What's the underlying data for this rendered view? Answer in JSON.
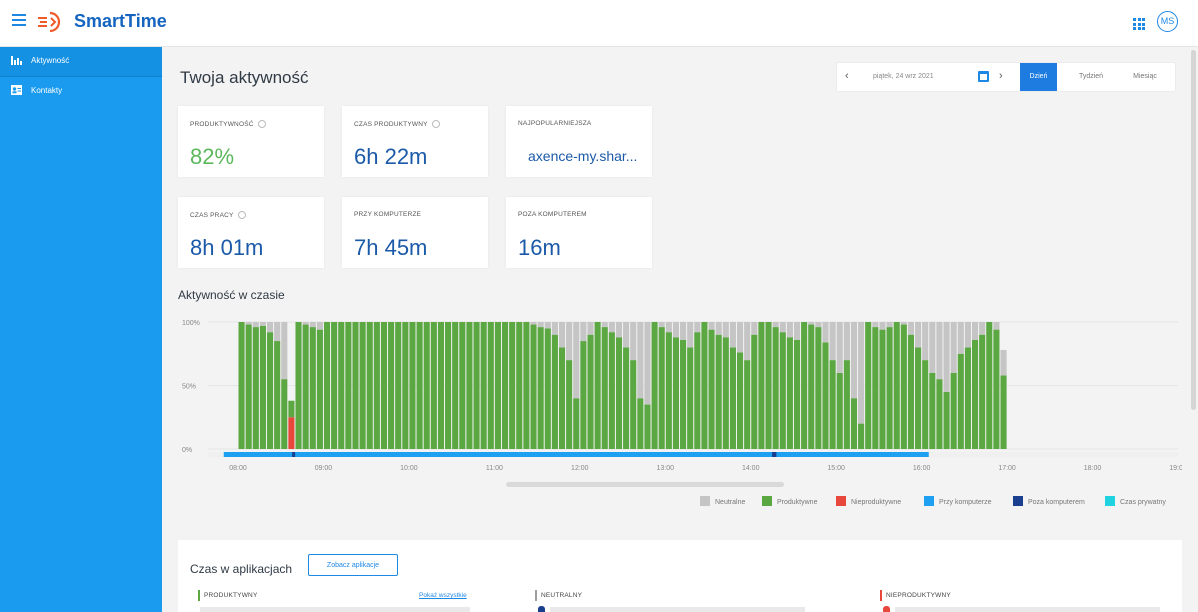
{
  "app": {
    "brand": "SmartTime",
    "user_initials": "MS"
  },
  "sidebar": {
    "items": [
      {
        "label": "Aktywność",
        "icon": "bar-chart-icon",
        "active": true
      },
      {
        "label": "Kontakty",
        "icon": "contact-card-icon",
        "active": false
      }
    ]
  },
  "page": {
    "title": "Twoja aktywność"
  },
  "date_nav": {
    "date": "piątek, 24 wrz 2021",
    "tabs": [
      {
        "label": "Dzień",
        "active": true
      },
      {
        "label": "Tydzień",
        "active": false
      },
      {
        "label": "Miesiąc",
        "active": false
      }
    ]
  },
  "stats": {
    "productivity": {
      "label": "PRODUKTYWNOŚĆ",
      "value": "82%"
    },
    "productive_time": {
      "label": "CZAS PRODUKTYWNY",
      "value": "6h 22m"
    },
    "most_popular": {
      "label": "NAJPOPULARNIEJSZA",
      "value": "axence-my.shar..."
    },
    "work_time": {
      "label": "CZAS PRACY",
      "value": "8h 01m"
    },
    "at_computer": {
      "label": "PRZY KOMPUTERZE",
      "value": "7h 45m"
    },
    "away": {
      "label": "POZA KOMPUTEREM",
      "value": "16m"
    }
  },
  "activity_section": {
    "title": "Aktywność w czasie"
  },
  "chart_data": {
    "type": "bar",
    "stacked": true,
    "y_ticks": [
      "100%",
      "50%",
      "0%"
    ],
    "ylim": [
      0,
      100
    ],
    "x_ticks": [
      "08:00",
      "09:00",
      "10:00",
      "11:00",
      "12:00",
      "13:00",
      "14:00",
      "15:00",
      "16:00",
      "17:00",
      "18:00",
      "19:00"
    ],
    "grid": true,
    "legend_position": "bottom-right",
    "bucket_minutes": 5,
    "start_time": "07:50",
    "productive": [
      0,
      0,
      100,
      98,
      96,
      97,
      92,
      85,
      55,
      13,
      100,
      98,
      96,
      94,
      100,
      100,
      100,
      100,
      100,
      100,
      100,
      100,
      100,
      100,
      100,
      100,
      100,
      100,
      100,
      100,
      100,
      100,
      100,
      100,
      100,
      100,
      100,
      100,
      100,
      100,
      100,
      100,
      100,
      98,
      96,
      95,
      90,
      80,
      70,
      40,
      85,
      90,
      100,
      96,
      92,
      88,
      80,
      70,
      40,
      35,
      100,
      96,
      92,
      88,
      86,
      80,
      92,
      100,
      94,
      90,
      88,
      80,
      76,
      70,
      90,
      100,
      100,
      96,
      92,
      88,
      86,
      100,
      98,
      96,
      84,
      70,
      60,
      70,
      40,
      20,
      100,
      96,
      94,
      96,
      100,
      98,
      90,
      80,
      70,
      60,
      55,
      45,
      60,
      75,
      80,
      86,
      90,
      100,
      94,
      58
    ],
    "unproductive": [
      0,
      0,
      0,
      0,
      0,
      0,
      0,
      0,
      0,
      25,
      0,
      0,
      0,
      0,
      0,
      0,
      0,
      0,
      0,
      0,
      0,
      0,
      0,
      0,
      0,
      0,
      0,
      0,
      0,
      0,
      0,
      0,
      0,
      0,
      0,
      0,
      0,
      0,
      0,
      0,
      0,
      0,
      0,
      0,
      0,
      0,
      0,
      0,
      0,
      0,
      0,
      0,
      0,
      0,
      0,
      0,
      0,
      0,
      0,
      0,
      0,
      0,
      0,
      0,
      0,
      0,
      0,
      0,
      0,
      0,
      0,
      0,
      0,
      0,
      0,
      0,
      0,
      0,
      0,
      0,
      0,
      0,
      0,
      0,
      0,
      0,
      0,
      0,
      0,
      0,
      0,
      0,
      0,
      0,
      0,
      0,
      0,
      0,
      0,
      0,
      0,
      0,
      0,
      0,
      0,
      0,
      0,
      0,
      0,
      0
    ],
    "neutral": [
      0,
      0,
      0,
      2,
      4,
      3,
      8,
      15,
      45,
      0,
      0,
      2,
      4,
      6,
      0,
      0,
      0,
      0,
      0,
      0,
      0,
      0,
      0,
      0,
      0,
      0,
      0,
      0,
      0,
      0,
      0,
      0,
      0,
      0,
      0,
      0,
      0,
      0,
      0,
      0,
      0,
      0,
      0,
      2,
      4,
      5,
      10,
      20,
      30,
      60,
      15,
      10,
      0,
      4,
      8,
      12,
      20,
      30,
      60,
      65,
      0,
      4,
      8,
      12,
      14,
      20,
      8,
      0,
      6,
      10,
      12,
      20,
      24,
      30,
      10,
      0,
      0,
      4,
      8,
      12,
      14,
      0,
      2,
      4,
      16,
      30,
      40,
      30,
      60,
      80,
      0,
      4,
      6,
      4,
      0,
      2,
      10,
      20,
      30,
      40,
      45,
      55,
      40,
      25,
      20,
      14,
      10,
      0,
      6,
      20
    ],
    "timeline": {
      "at_computer": [
        [
          "07:50",
          "16:05"
        ]
      ],
      "away": [
        [
          "08:38",
          "08:40"
        ],
        [
          "14:15",
          "14:18"
        ]
      ]
    },
    "series_colors": {
      "neutral": "#c5c5c5",
      "productive": "#5ba843",
      "unproductive": "#e8473c",
      "at_computer": "#1ea0f2",
      "away": "#1a3f8f",
      "private": "#1ed2e0"
    }
  },
  "legend": [
    {
      "label": "Neutralne",
      "color": "#c5c5c5"
    },
    {
      "label": "Produktywne",
      "color": "#5ba843"
    },
    {
      "label": "Nieproduktywne",
      "color": "#e8473c"
    },
    {
      "label": "Przy komputerze",
      "color": "#1ea0f2"
    },
    {
      "label": "Poza komputerem",
      "color": "#1a3f8f"
    },
    {
      "label": "Czas prywatny",
      "color": "#1ed2e0"
    }
  ],
  "apps": {
    "title": "Czas w aplikacjach",
    "button": "Zobacz aplikacje",
    "categories": [
      {
        "label": "PRODUKTYWNY",
        "color": "#5ba843"
      },
      {
        "label": "NEUTRALNY",
        "color": "#9e9e9e"
      },
      {
        "label": "NIEPRODUKTYWNY",
        "color": "#e8473c"
      }
    ],
    "show_all": "Pokaż wszystkie"
  }
}
